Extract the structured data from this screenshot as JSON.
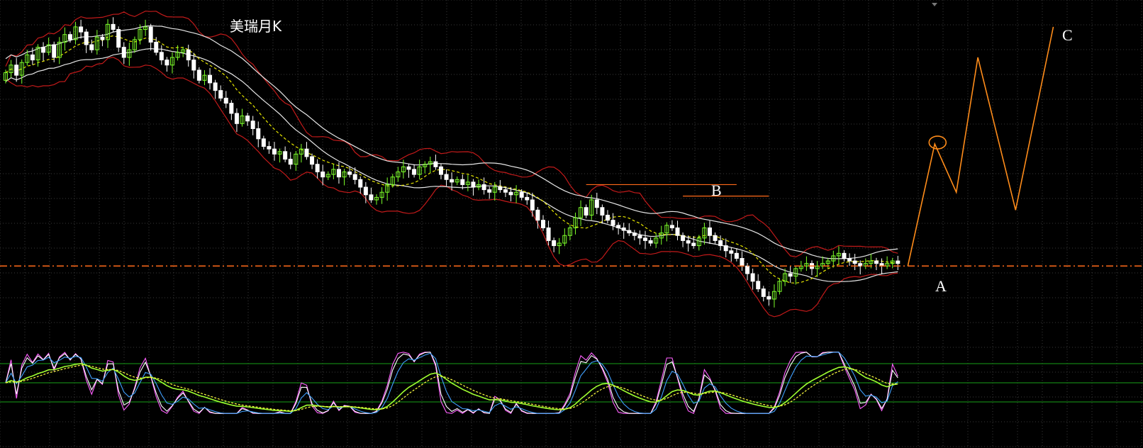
{
  "chart_data": {
    "type": "candlestick",
    "title": "美瑞月K",
    "background": "#000000",
    "colors": {
      "grid": "#3a3a3a",
      "candle_up": "#7dff2a",
      "candle_down": "#ffffff",
      "band_outer": "#c21a1a",
      "band_inner": "#e6e6e6",
      "ma_dash": "#e8e800",
      "ref_line": "#ff6a1a",
      "wave": "#ff8c1a",
      "k_line": "#ffffff",
      "d_line": "#40a0ff",
      "j_line": "#ff60ff",
      "slow_line": "#a0ff30",
      "slow_dash": "#ffff40",
      "osc_level": "#18a018",
      "label_text": "#ffffff"
    },
    "reference_level": 1.0,
    "close": [
      8.6,
      8.9,
      8.5,
      9.0,
      9.3,
      9.1,
      9.6,
      9.4,
      9.7,
      9.2,
      9.8,
      10.1,
      9.9,
      10.4,
      10.2,
      9.7,
      9.5,
      10.0,
      9.9,
      10.5,
      10.3,
      9.6,
      9.2,
      9.5,
      9.9,
      10.3,
      10.4,
      9.8,
      9.4,
      9.1,
      8.9,
      9.2,
      9.4,
      9.5,
      9.1,
      8.7,
      8.3,
      8.5,
      8.2,
      7.9,
      7.6,
      7.4,
      7.0,
      6.6,
      6.9,
      6.7,
      6.4,
      6.0,
      5.7,
      5.6,
      5.4,
      5.5,
      5.2,
      5.0,
      5.4,
      5.6,
      5.3,
      5.0,
      4.7,
      4.5,
      4.6,
      4.8,
      4.5,
      4.7,
      4.6,
      4.4,
      4.1,
      3.8,
      3.6,
      3.7,
      3.9,
      4.2,
      4.5,
      4.7,
      4.9,
      4.8,
      4.6,
      4.9,
      5.0,
      5.1,
      4.9,
      4.6,
      4.4,
      4.3,
      4.4,
      4.2,
      4.3,
      4.1,
      4.2,
      4.0,
      3.9,
      4.1,
      4.0,
      3.9,
      3.8,
      3.9,
      3.7,
      3.6,
      3.2,
      2.8,
      2.5,
      2.0,
      1.8,
      1.9,
      2.2,
      2.5,
      2.9,
      3.3,
      3.0,
      3.6,
      3.3,
      3.0,
      2.8,
      2.6,
      2.5,
      2.4,
      2.3,
      2.2,
      2.1,
      2.0,
      1.9,
      2.1,
      2.3,
      2.6,
      2.5,
      2.2,
      2.0,
      1.9,
      1.8,
      2.1,
      2.5,
      2.2,
      2.0,
      1.8,
      1.6,
      1.5,
      1.3,
      1.0,
      0.7,
      0.4,
      0.1,
      -0.2,
      -0.3,
      0.0,
      0.4,
      0.7,
      0.6,
      0.9,
      1.0,
      1.1,
      0.9,
      1.0,
      1.1,
      1.2,
      1.4,
      1.5,
      1.3,
      1.2,
      1.1,
      1.0,
      1.1,
      1.2,
      1.1,
      1.0,
      1.1,
      1.2,
      1.1
    ],
    "oscillator": {
      "levels": [
        80,
        50,
        20
      ],
      "series": [
        "K",
        "D",
        "J",
        "slow",
        "slow_signal"
      ]
    },
    "price_range": [
      -1.5,
      10.9
    ],
    "annotations": {
      "A": "A",
      "B": "B",
      "C": "C",
      "wave_path": [
        [
          0,
          1.0
        ],
        [
          5,
          5.8
        ],
        [
          9,
          3.9
        ],
        [
          13,
          9.2
        ],
        [
          20,
          3.2
        ],
        [
          27,
          10.4
        ]
      ]
    }
  }
}
